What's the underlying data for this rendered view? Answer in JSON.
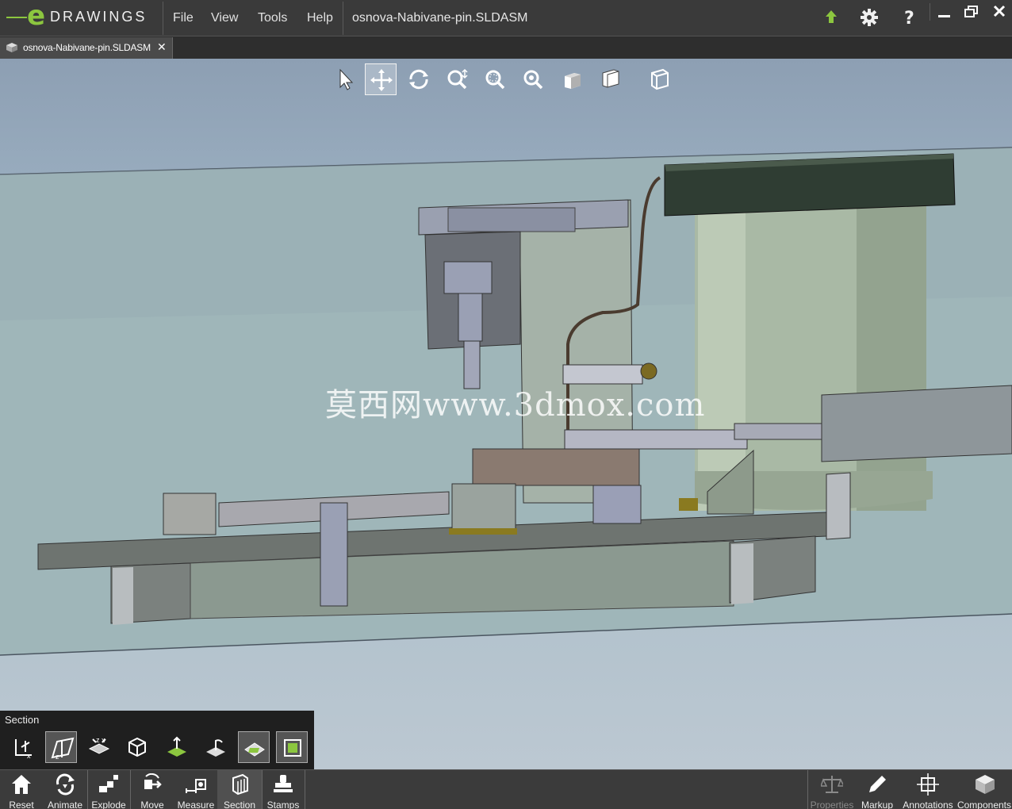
{
  "app": {
    "logo_text": "DRAWINGS",
    "logo_letter": "e"
  },
  "menu": [
    "File",
    "View",
    "Tools",
    "Help"
  ],
  "document_title": "osnova-Nabivane-pin.SLDASM",
  "tab": {
    "label": "osnova-Nabivane-pin.SLDASM",
    "close": "✕"
  },
  "title_icons": [
    "upload-arrow-icon",
    "gear-icon",
    "help-icon"
  ],
  "window_controls": [
    "minimize-icon",
    "restore-icon",
    "close-icon"
  ],
  "view_toolbar": {
    "tools": [
      "select-icon",
      "pan-icon",
      "rotate-icon",
      "zoom-icon",
      "zoom-to-area-icon",
      "zoom-to-fit-icon",
      "view-orientation-icon",
      "display-style-icon",
      "view-cube-icon"
    ],
    "active": "pan-icon"
  },
  "watermark": "莫西网www.3dmox.com",
  "section_panel": {
    "title": "Section",
    "tools": [
      "section-plane-x-icon",
      "section-plane-z-icon",
      "section-flip-icon",
      "section-box-icon",
      "section-move-icon",
      "section-rotate-icon",
      "section-cap-icon",
      "section-outline-icon"
    ]
  },
  "bottom_toolbar": {
    "left": [
      {
        "label": "Reset",
        "icon": "home-icon"
      },
      {
        "label": "Animate",
        "icon": "animate-icon"
      },
      {
        "label": "Explode",
        "icon": "explode-icon"
      },
      {
        "label": "Move",
        "icon": "move-icon"
      },
      {
        "label": "Measure",
        "icon": "measure-icon"
      },
      {
        "label": "Section",
        "icon": "section-icon"
      },
      {
        "label": "Stamps",
        "icon": "stamps-icon"
      }
    ],
    "right": [
      {
        "label": "Properties",
        "icon": "scales-icon",
        "enabled": false
      },
      {
        "label": "Markup",
        "icon": "pencil-icon",
        "enabled": true
      },
      {
        "label": "Annotations",
        "icon": "annotation-icon",
        "enabled": true
      },
      {
        "label": "Components",
        "icon": "components-icon",
        "enabled": true
      }
    ]
  },
  "colors": {
    "accent": "#8cc63f",
    "chrome": "#3a3a3a",
    "viewport_top": "#8d9fb3",
    "viewport_bottom": "#bcc8d2"
  }
}
